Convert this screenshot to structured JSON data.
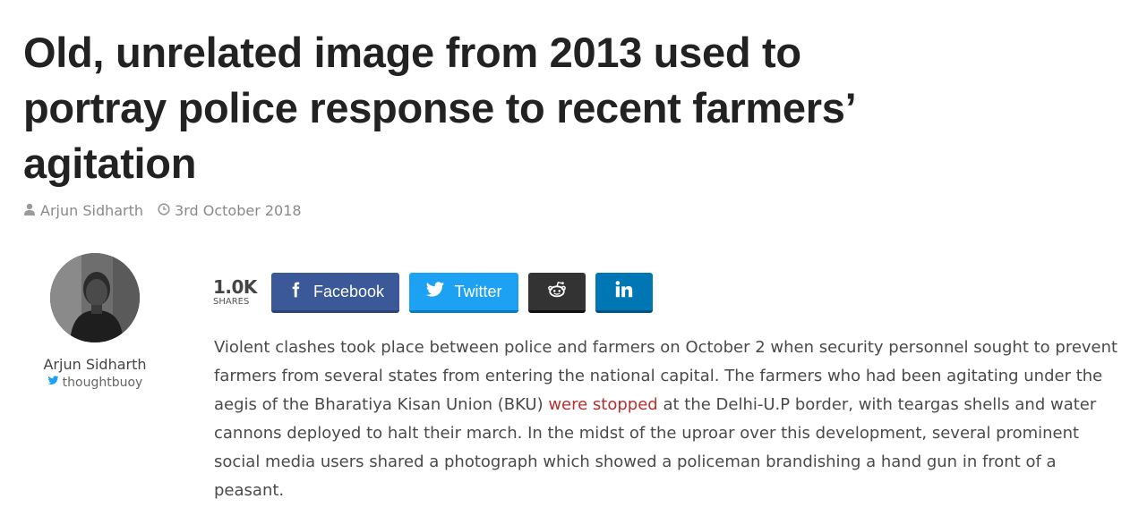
{
  "article": {
    "title": "Old, unrelated image from 2013 used to portray police response to recent farmers’ agitation",
    "author": "Arjun Sidharth",
    "date": "3rd October 2018"
  },
  "author_box": {
    "name": "Arjun Sidharth",
    "handle": "thoughtbuoy"
  },
  "share": {
    "count": "1.0K",
    "count_label": "SHARES",
    "facebook": "Facebook",
    "twitter": "Twitter"
  },
  "body": {
    "part1": "Violent clashes took place between police and farmers on October 2 when security personnel sought to prevent farmers from several states from entering the national capital. The farmers who had been agitating under the aegis of the Bharatiya Kisan Union (BKU) ",
    "link": "were stopped",
    "part2": " at the Delhi-U.P border, with teargas shells and water cannons deployed to halt their march. In the midst of the uproar over this development, several prominent social media users shared a photograph which showed a policeman brandishing a hand gun in front of a peasant."
  },
  "colors": {
    "facebook": "#3b5998",
    "twitter": "#1da1f2",
    "reddit": "#333333",
    "linkedin": "#0077b5",
    "link": "#b53030"
  },
  "icons": [
    "user-icon",
    "clock-icon",
    "twitter-bird-icon",
    "facebook-icon",
    "reddit-icon",
    "linkedin-icon"
  ]
}
